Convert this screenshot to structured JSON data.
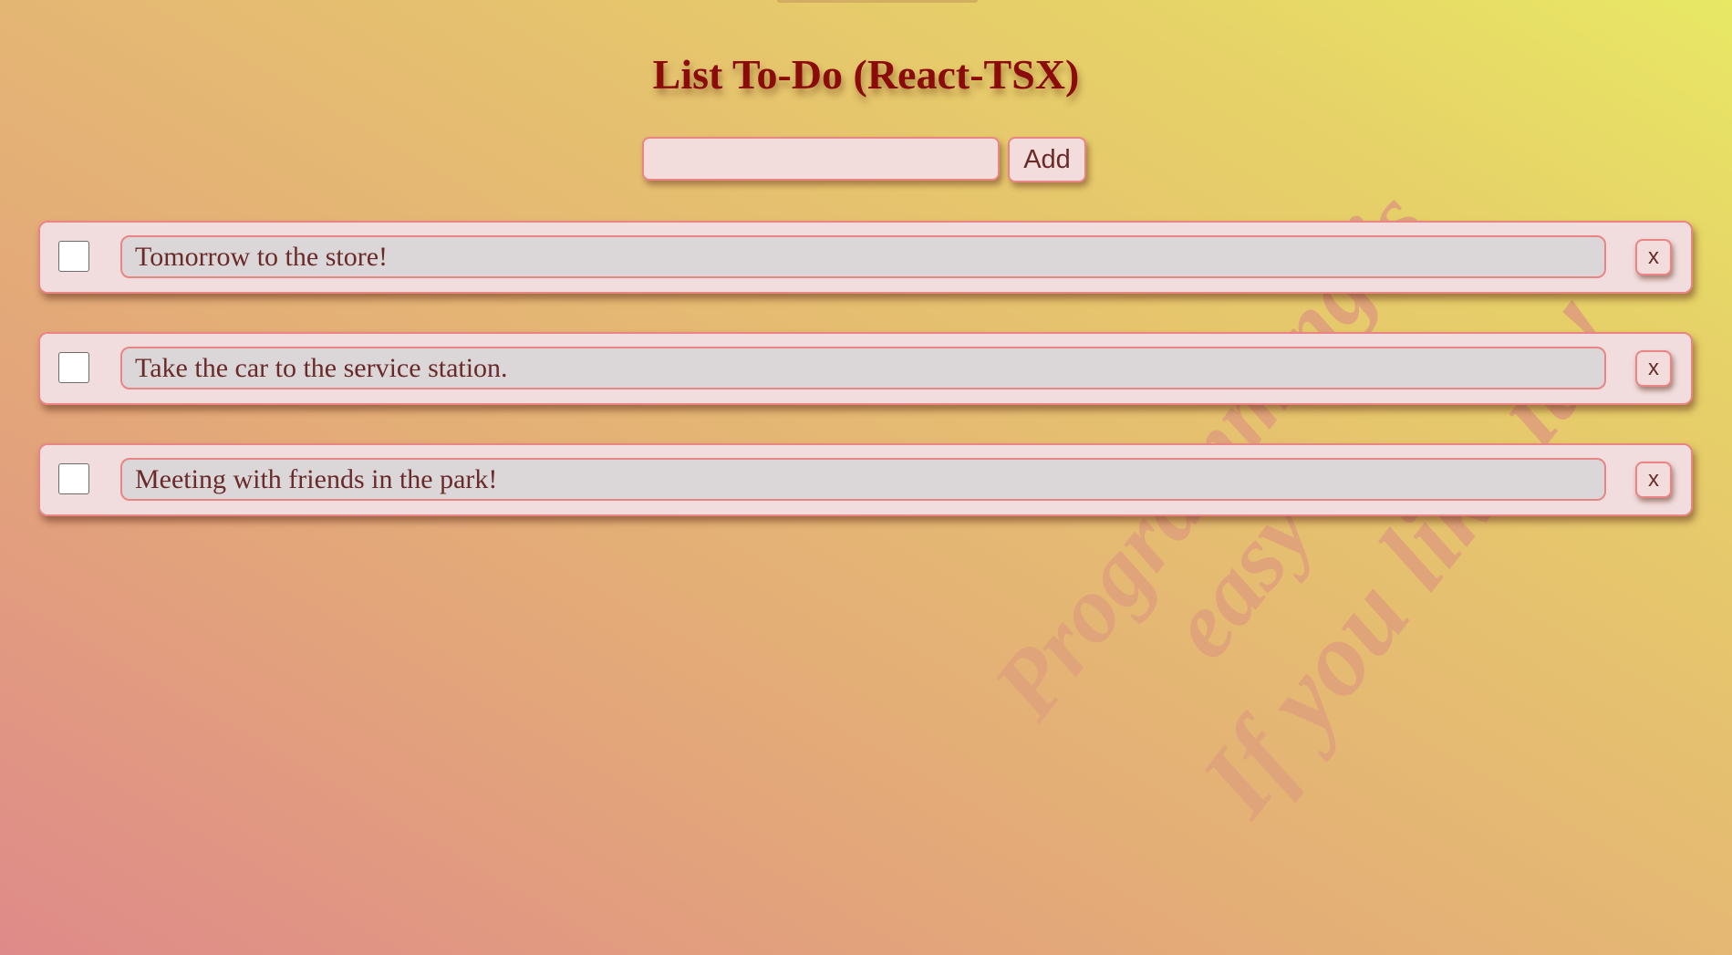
{
  "app": {
    "title": "List To-Do (React-TSX)"
  },
  "new_todo": {
    "value": "",
    "placeholder": "",
    "add_label": "Add"
  },
  "todos": [
    {
      "text": "Tomorrow to the store!",
      "done": false,
      "delete_label": "x"
    },
    {
      "text": "Take the car to the service station.",
      "done": false,
      "delete_label": "x"
    },
    {
      "text": "Meeting with friends in the park!",
      "done": false,
      "delete_label": "x"
    }
  ],
  "watermark": {
    "lines": [
      "Programming is",
      "easy",
      "If you like it!!"
    ]
  },
  "colors": {
    "title": "#8b0a0a",
    "accent_border": "#e98585",
    "panel": "#f1dddd",
    "text": "#6b2a2a",
    "watermark": "#e0a47a"
  }
}
